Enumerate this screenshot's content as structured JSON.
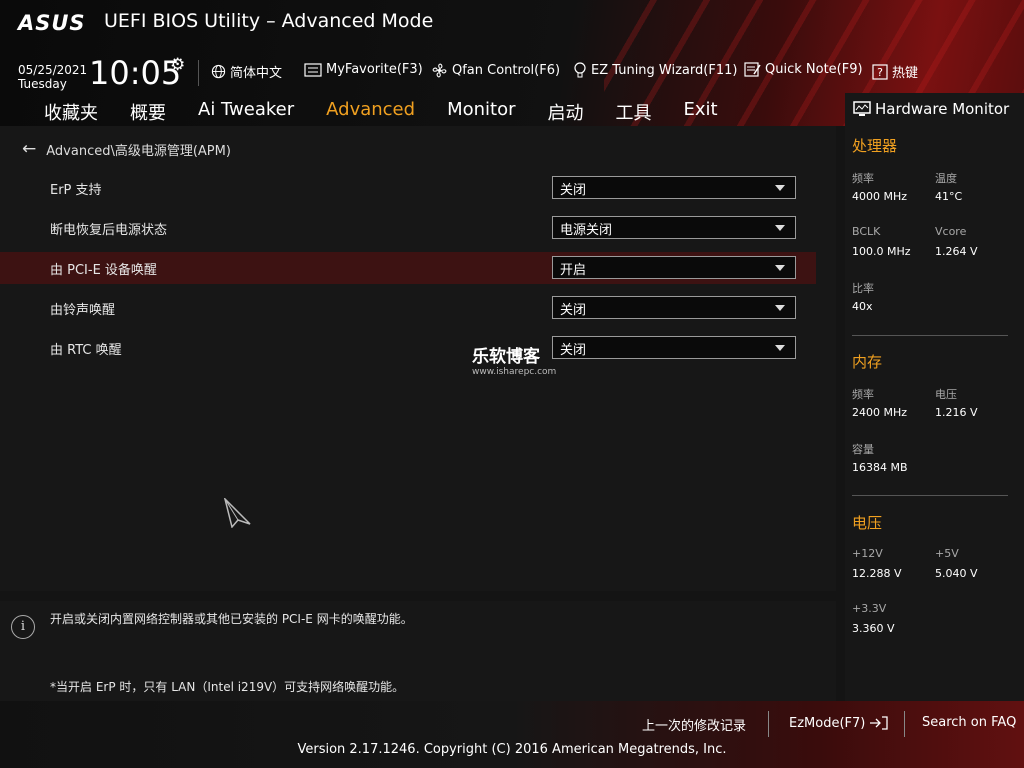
{
  "header": {
    "logo": "ASUS",
    "title": "UEFI BIOS Utility – Advanced Mode",
    "date": "05/25/2021",
    "day": "Tuesday",
    "time": "10:05",
    "toolbar": [
      {
        "label": "简体中文",
        "icon": "globe-icon"
      },
      {
        "label": "MyFavorite(F3)",
        "icon": "favorite-list-icon"
      },
      {
        "label": "Qfan Control(F6)",
        "icon": "fan-icon"
      },
      {
        "label": "EZ Tuning Wizard(F11)",
        "icon": "lightbulb-icon"
      },
      {
        "label": "Quick Note(F9)",
        "icon": "note-icon"
      },
      {
        "label": "热键",
        "icon": "hotkey-icon"
      }
    ]
  },
  "tabs": [
    {
      "label": "收藏夹",
      "active": false
    },
    {
      "label": "概要",
      "active": false
    },
    {
      "label": "Ai Tweaker",
      "active": false
    },
    {
      "label": "Advanced",
      "active": true
    },
    {
      "label": "Monitor",
      "active": false
    },
    {
      "label": "启动",
      "active": false
    },
    {
      "label": "工具",
      "active": false
    },
    {
      "label": "Exit",
      "active": false
    }
  ],
  "main": {
    "breadcrumb": "Advanced\\高级电源管理(APM)",
    "settings": [
      {
        "label": "ErP 支持",
        "value": "关闭",
        "highlighted": false
      },
      {
        "label": "断电恢复后电源状态",
        "value": "电源关闭",
        "highlighted": false
      },
      {
        "label": "由 PCI-E 设备唤醒",
        "value": "开启",
        "highlighted": true
      },
      {
        "label": "由铃声唤醒",
        "value": "关闭",
        "highlighted": false
      },
      {
        "label": "由 RTC 唤醒",
        "value": "关闭",
        "highlighted": false
      }
    ],
    "watermark": {
      "name": "乐软博客",
      "url": "www.isharepc.com"
    }
  },
  "help": {
    "line1": "开启或关闭内置网络控制器或其他已安装的 PCI-E 网卡的唤醒功能。",
    "line2": "*当开启 ErP 时，只有 LAN（Intel i219V）可支持网络唤醒功能。"
  },
  "hw_monitor": {
    "title": "Hardware Monitor",
    "cpu": {
      "heading": "处理器",
      "freq_label": "频率",
      "freq": "4000 MHz",
      "temp_label": "温度",
      "temp": "41°C",
      "bclk_label": "BCLK",
      "bclk": "100.0 MHz",
      "vcore_label": "Vcore",
      "vcore": "1.264 V",
      "ratio_label": "比率",
      "ratio": "40x"
    },
    "memory": {
      "heading": "内存",
      "freq_label": "频率",
      "freq": "2400 MHz",
      "volt_label": "电压",
      "volt": "1.216 V",
      "cap_label": "容量",
      "cap": "16384 MB"
    },
    "voltage": {
      "heading": "电压",
      "v12_label": "+12V",
      "v12": "12.288 V",
      "v5_label": "+5V",
      "v5": "5.040 V",
      "v33_label": "+3.3V",
      "v33": "3.360 V"
    }
  },
  "footer": {
    "last_changes": "上一次的修改记录",
    "ezmode": "EzMode(F7)",
    "faq": "Search on FAQ",
    "copyright": "Version 2.17.1246. Copyright (C) 2016 American Megatrends, Inc."
  },
  "colors": {
    "accent": "#f0a020",
    "highlight_row": "#3d1212",
    "brand_red": "#7a1111"
  }
}
